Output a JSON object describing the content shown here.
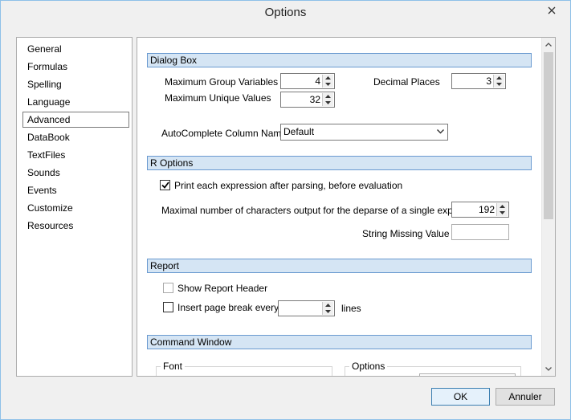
{
  "window": {
    "title": "Options"
  },
  "sidebar": {
    "items": [
      {
        "label": "General",
        "selected": false
      },
      {
        "label": "Formulas",
        "selected": false
      },
      {
        "label": "Spelling",
        "selected": false
      },
      {
        "label": "Language",
        "selected": false
      },
      {
        "label": "Advanced",
        "selected": true
      },
      {
        "label": "DataBook",
        "selected": false
      },
      {
        "label": "TextFiles",
        "selected": false
      },
      {
        "label": "Sounds",
        "selected": false
      },
      {
        "label": "Events",
        "selected": false
      },
      {
        "label": "Customize",
        "selected": false
      },
      {
        "label": "Resources",
        "selected": false
      }
    ]
  },
  "dialog_box": {
    "header": "Dialog Box",
    "max_group_variables_label": "Maximum Group Variables",
    "max_group_variables_value": "4",
    "max_unique_values_label": "Maximum Unique Values",
    "max_unique_values_value": "32",
    "decimal_places_label": "Decimal Places",
    "decimal_places_value": "3",
    "autocomplete_label": "AutoComplete Column Name",
    "autocomplete_value": "Default"
  },
  "r_options": {
    "header": "R Options",
    "print_expression_label": "Print each expression after parsing, before evaluation",
    "print_expression_checked": true,
    "max_chars_label": "Maximal number of characters output for the deparse of a single expression",
    "max_chars_value": "192",
    "string_missing_label": "String Missing Value",
    "string_missing_value": ""
  },
  "report": {
    "header": "Report",
    "show_header_label": "Show Report Header",
    "show_header_checked": false,
    "page_break_label": "Insert page break every",
    "page_break_checked": false,
    "page_break_value": "",
    "lines_label": "lines"
  },
  "command_window": {
    "header": "Command Window",
    "font_group": "Font",
    "options_group": "Options"
  },
  "buttons": {
    "ok": "OK",
    "cancel": "Annuler"
  },
  "colors": {
    "section_header_bg": "#d5e5f4",
    "section_header_border": "#6a9ad0",
    "window_border": "#8ec0e8"
  }
}
